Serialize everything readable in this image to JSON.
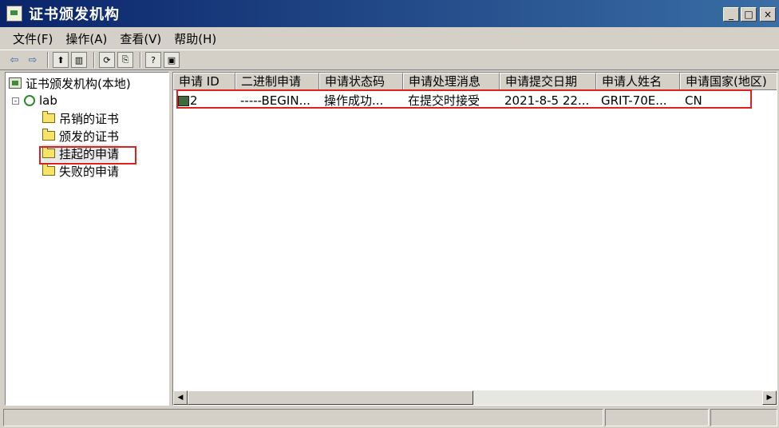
{
  "window": {
    "title": "证书颁发机构"
  },
  "title_buttons": {
    "minimize": "_",
    "maximize": "□",
    "close": "×"
  },
  "menu": [
    "文件(F)",
    "操作(A)",
    "查看(V)",
    "帮助(H)"
  ],
  "toolbar": {
    "icons": [
      "back-arrow-icon",
      "forward-arrow-icon",
      "up-folder-icon",
      "show-tree-icon",
      "refresh-icon",
      "export-list-icon",
      "help-icon",
      "console-icon"
    ],
    "glyphs": {
      "back": "⇦",
      "forward": "⇨",
      "up": "⬆",
      "tree": "▥",
      "refresh": "⟳",
      "export": "⎘",
      "help": "?",
      "console": "▣"
    }
  },
  "tree": {
    "root": "证书颁发机构(本地)",
    "ca": {
      "label": "lab",
      "expander": "-"
    },
    "folders": [
      "吊销的证书",
      "颁发的证书",
      "挂起的申请",
      "失败的申请"
    ],
    "selected": "挂起的申请"
  },
  "table": {
    "columns": [
      "申请 ID",
      "二进制申请",
      "申请状态码",
      "申请处理消息",
      "申请提交日期",
      "申请人姓名",
      "申请国家(地区)"
    ],
    "rows": [
      [
        "2",
        "-----BEGIN...",
        "操作成功...",
        "在提交时接受",
        "2021-8-5 22...",
        "GRIT-70E...",
        "CN"
      ]
    ]
  },
  "scrollbar": {
    "left_arrow": "◀",
    "right_arrow": "▶"
  },
  "colors": {
    "title_start": "#0a246a",
    "title_end": "#3a6ea5",
    "highlight": "#e02020",
    "face": "#d4d0c8"
  }
}
